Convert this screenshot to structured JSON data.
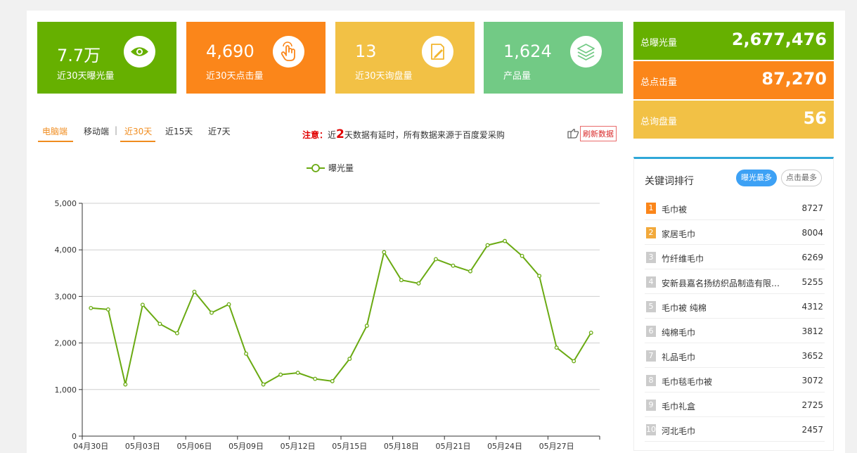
{
  "stats": [
    {
      "value": "7.7万",
      "label": "近30天曝光量",
      "color": "#66b000",
      "icon": "eye-icon"
    },
    {
      "value": "4,690",
      "label": "近30天点击量",
      "color": "#fb861a",
      "icon": "hand-click-icon"
    },
    {
      "value": "13",
      "label": "近30天询盘量",
      "color": "#f2c145",
      "icon": "edit-document-icon"
    },
    {
      "value": "1,624",
      "label": "产品量",
      "color": "#72ca85",
      "icon": "layers-icon"
    }
  ],
  "totals": [
    {
      "label": "总曝光量",
      "value": "2,677,476",
      "color": "#66b000"
    },
    {
      "label": "总点击量",
      "value": "87,270",
      "color": "#fb861a"
    },
    {
      "label": "总询盘量",
      "value": "56",
      "color": "#f2c145"
    }
  ],
  "tabs": {
    "device": [
      "电脑端",
      "移动端"
    ],
    "range": [
      "近30天",
      "近15天",
      "近7天"
    ],
    "separator": "|"
  },
  "notice": {
    "prefix": "注意：",
    "before": "近",
    "days": "2",
    "after": "天数据有延时，所有数据来源于百度爱采购"
  },
  "refresh_label": "刷新数据",
  "chart_data": {
    "type": "line",
    "series": [
      {
        "name": "曝光量",
        "color": "#6aaa12",
        "values": [
          2750,
          2720,
          1110,
          2820,
          2410,
          2210,
          3100,
          2650,
          2830,
          1770,
          1110,
          1320,
          1360,
          1230,
          1180,
          1660,
          2370,
          3950,
          3350,
          3280,
          3800,
          3660,
          3540,
          4100,
          4190,
          3870,
          3440,
          1900,
          1610,
          2220
        ]
      }
    ],
    "x_tick_labels": [
      "04月30日",
      "05月03日",
      "05月06日",
      "05月09日",
      "05月12日",
      "05月15日",
      "05月18日",
      "05月21日",
      "05月24日",
      "05月27日"
    ],
    "y_ticks": [
      "0",
      "1,000",
      "2,000",
      "3,000",
      "4,000",
      "5,000"
    ],
    "ylim": [
      0,
      5000
    ],
    "grid": true,
    "legend_position": "top-center"
  },
  "keywords": {
    "title": "关键词排行",
    "tab_on": "曝光最多",
    "tab_off": "点击最多",
    "items": [
      {
        "rank": "1",
        "name": "毛巾被",
        "value": "8727",
        "rank_color": "#fb861a"
      },
      {
        "rank": "2",
        "name": "家居毛巾",
        "value": "8004",
        "rank_color": "#f2a93b"
      },
      {
        "rank": "3",
        "name": "竹纤维毛巾",
        "value": "6269",
        "rank_color": "#cccccc"
      },
      {
        "rank": "4",
        "name": "安新县嘉名扬纺织品制造有限公司",
        "value": "5255",
        "rank_color": "#cccccc"
      },
      {
        "rank": "5",
        "name": "毛巾被 纯棉",
        "value": "4312",
        "rank_color": "#cccccc"
      },
      {
        "rank": "6",
        "name": "纯棉毛巾",
        "value": "3812",
        "rank_color": "#cccccc"
      },
      {
        "rank": "7",
        "name": "礼品毛巾",
        "value": "3652",
        "rank_color": "#cccccc"
      },
      {
        "rank": "8",
        "name": "毛巾毯毛巾被",
        "value": "3072",
        "rank_color": "#cccccc"
      },
      {
        "rank": "9",
        "name": "毛巾礼盒",
        "value": "2725",
        "rank_color": "#cccccc"
      },
      {
        "rank": "10",
        "name": "河北毛巾",
        "value": "2457",
        "rank_color": "#cccccc"
      }
    ]
  }
}
